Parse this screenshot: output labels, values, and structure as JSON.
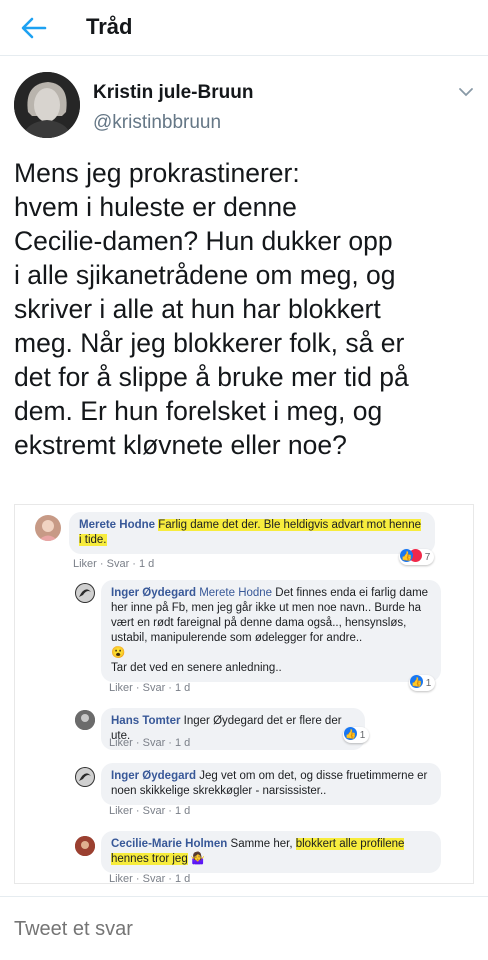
{
  "header": {
    "title": "Tråd",
    "back_icon": "arrow-left-icon"
  },
  "tweet": {
    "display_name": "Kristin jule-Bruun",
    "handle": "@kristinbbruun",
    "lines": [
      "Mens jeg prokrastinerer:",
      "hvem i huleste er denne",
      "Cecilie-damen? Hun dukker opp",
      "i alle sjikanetrådene om meg, og",
      "skriver i alle at hun har blokkert",
      "meg. Når jeg blokkerer folk, så er",
      "det for å slippe å bruke mer tid på",
      "dem. Er hun forelsket i meg, og",
      "ekstremt kløvnete eller noe?"
    ]
  },
  "fb_comments": [
    {
      "name": "Merete Hodne",
      "text_plain": "",
      "text_highlight": "Farlig dame det der. Ble heldigvis advart mot henne i tide.",
      "actions": "Liker · Svar · 1 d",
      "reaction_count": "7"
    },
    {
      "name": "Inger Øydegard",
      "mention": "Merete Hodne",
      "text": "Det finnes enda ei farlig dame her inne på Fb, men jeg går ikke ut men noe navn.. Burde ha vært en rødt fareignal på denne dama også.., hensynsløs, ustabil, manipulerende som ødelegger for andre..",
      "emoji": "😮",
      "text2": "Tar det ved en senere anledning..",
      "actions": "Liker · Svar · 1 d",
      "reaction_count": "1"
    },
    {
      "name": "Hans Tomter",
      "text": "Inger Øydegard det er flere der ute.",
      "actions": "Liker · Svar · 1 d",
      "reaction_count": "1"
    },
    {
      "name": "Inger Øydegard",
      "text": "Jeg vet om om det, og disse fruetimmerne er noen skikkelige skrekkøgler - narsissister..",
      "actions": "Liker · Svar · 1 d"
    },
    {
      "name": "Cecilie-Marie Holmen",
      "text_plain": "Samme her,",
      "text_highlight": "blokkert alle profilene hennes tror jeg",
      "emoji": "🤷‍♀️",
      "actions": "Liker · Svar · 1 d"
    }
  ],
  "reply": {
    "placeholder": "Tweet et svar"
  },
  "colors": {
    "accent": "#1da1f2",
    "highlight": "#f7ec3d",
    "fb_name": "#385898"
  }
}
